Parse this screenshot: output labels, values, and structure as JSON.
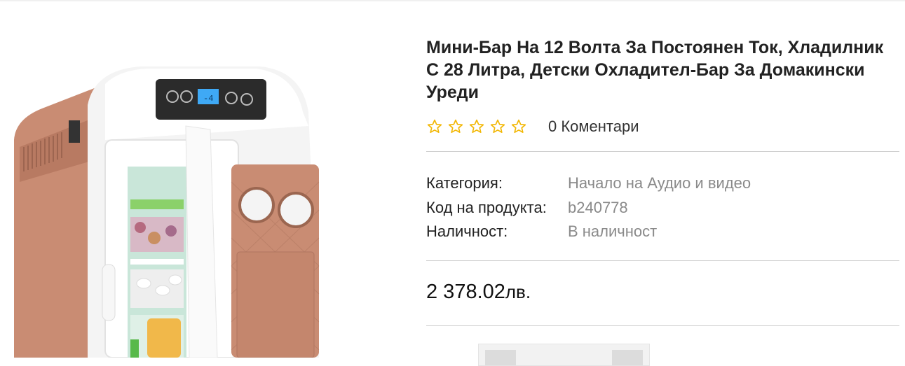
{
  "product": {
    "title": "Мини-Бар На 12 Волта За Постоянен Ток, Хладилник С 28 Литра, Детски Охладител-Бар За Домакински Уреди",
    "rating": 0,
    "max_rating": 5,
    "reviews_label": "0 Коментари",
    "meta": [
      {
        "label": "Категория:",
        "value": "Начало на Аудио и видео"
      },
      {
        "label": "Код на продукта:",
        "value": "b240778"
      },
      {
        "label": "Наличност:",
        "value": "В наличност"
      }
    ],
    "price": {
      "amount": "2 378.02",
      "currency": "лв."
    },
    "image_icon": "mini-fridge-photo"
  },
  "colors": {
    "star": "#f2b705",
    "divider": "#cfcfcf",
    "fridge_body": "#c98c73",
    "fridge_trim": "#ffffff"
  }
}
